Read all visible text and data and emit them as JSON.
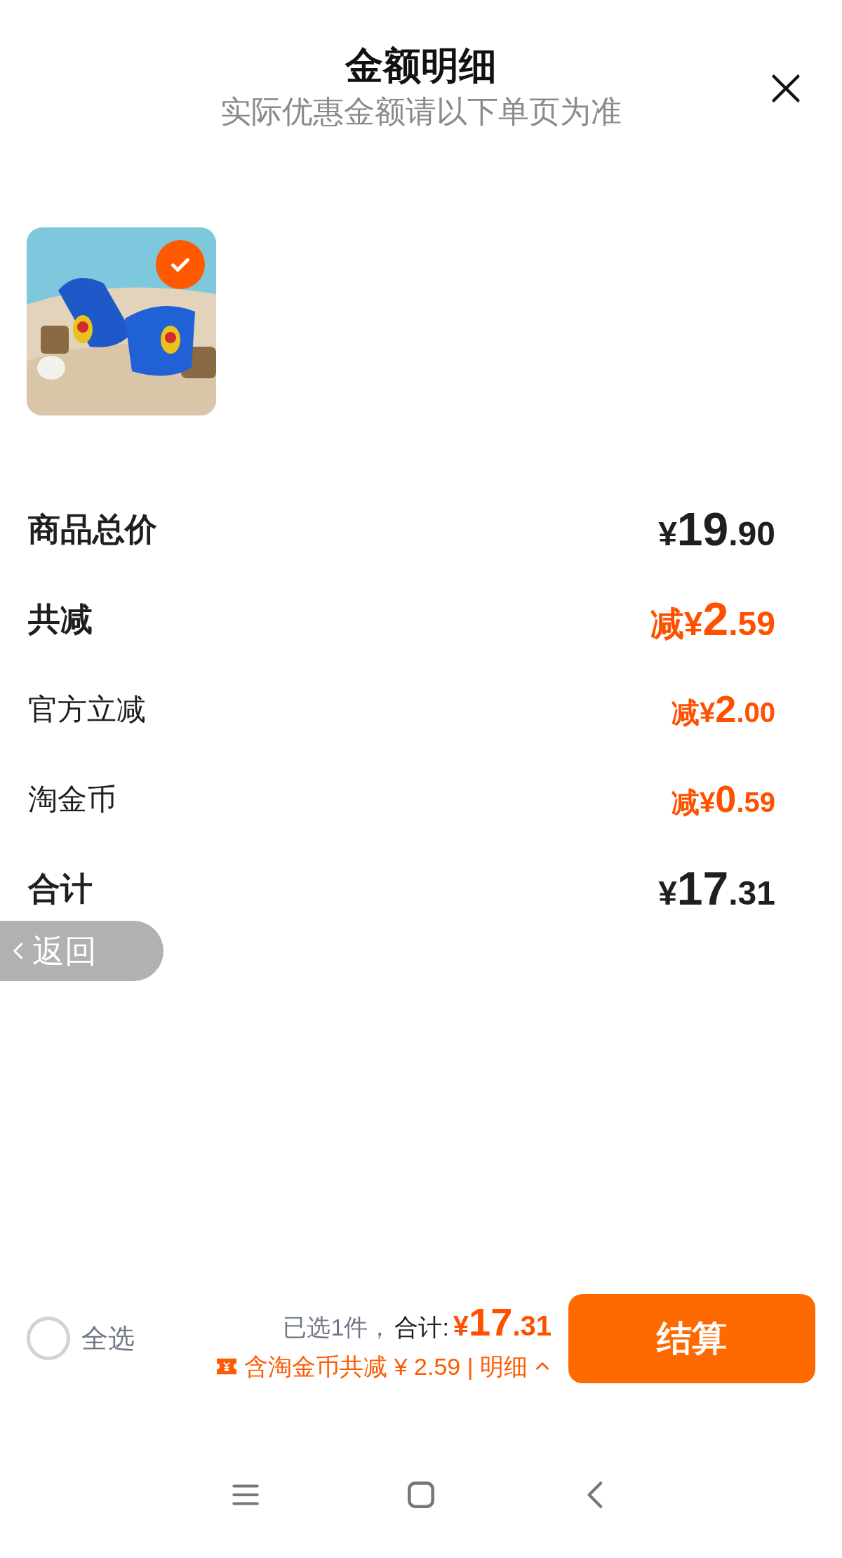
{
  "header": {
    "title": "金额明细",
    "subtitle": "实际优惠金额请以下单页为准"
  },
  "product": {
    "checked": true
  },
  "rows": [
    {
      "label": "商品总价",
      "kind": "total",
      "prefix": "",
      "currency": "¥",
      "integer": "19",
      "decimal": ".90"
    },
    {
      "label": "共减",
      "kind": "discount_total",
      "prefix": "减",
      "currency": "¥",
      "integer": "2",
      "decimal": ".59"
    },
    {
      "label": "官方立减",
      "kind": "discount",
      "prefix": "减",
      "currency": "¥",
      "integer": "2",
      "decimal": ".00"
    },
    {
      "label": "淘金币",
      "kind": "discount",
      "prefix": "减",
      "currency": "¥",
      "integer": "0",
      "decimal": ".59"
    },
    {
      "label": "合计",
      "kind": "total",
      "prefix": "",
      "currency": "¥",
      "integer": "17",
      "decimal": ".31"
    }
  ],
  "back_button": {
    "label": "返回"
  },
  "footer": {
    "select_all": {
      "label": "全选",
      "checked": false
    },
    "selected_count": "已选1件，",
    "sum_label": "合计:",
    "sum_currency": "¥",
    "sum_integer": "17",
    "sum_decimal": ".31",
    "savings": "含淘金币共减 ¥ 2.59 | 明细",
    "checkout": "结算"
  }
}
